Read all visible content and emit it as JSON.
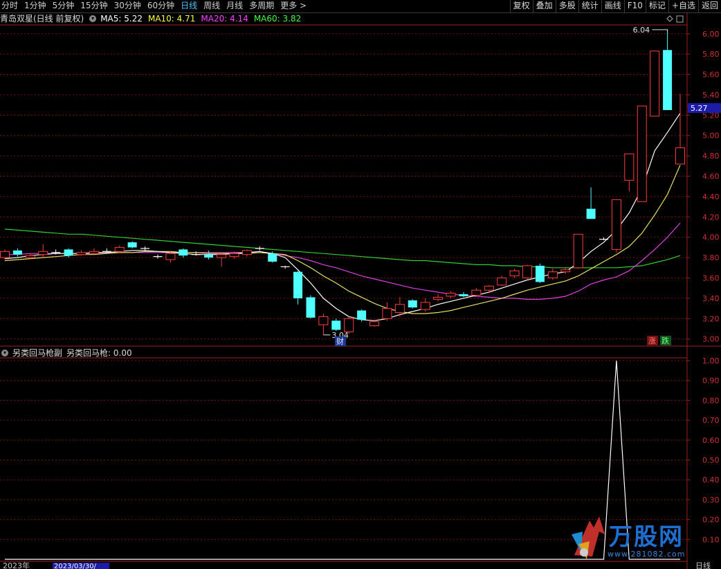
{
  "toolbar": {
    "periods": [
      "分时",
      "1分钟",
      "5分钟",
      "15分钟",
      "30分钟",
      "60分钟",
      "日线",
      "周线",
      "月线",
      "多周期",
      "更多 >"
    ],
    "active_period": "日线",
    "right_buttons": [
      "复权",
      "叠加",
      "多股",
      "统计",
      "画线",
      "F10",
      "标记",
      "+自选",
      "返回"
    ]
  },
  "main_info": {
    "stock": "青岛双星(日线 前复权)",
    "indicators": [
      {
        "label": "MA5: 5.22",
        "color": "#ffffff"
      },
      {
        "label": "MA10: 4.71",
        "color": "#ffff40"
      },
      {
        "label": "MA20: 4.14",
        "color": "#ff40ff"
      },
      {
        "label": "MA60: 3.82",
        "color": "#40ff40"
      }
    ]
  },
  "sub_info": {
    "name": "另类回马枪副",
    "value_label": "另类回马枪: 0.00"
  },
  "chart_data": [
    {
      "type": "candlestick",
      "y_ticks": [
        "6.00",
        "5.80",
        "5.60",
        "5.40",
        "5.20",
        "5.00",
        "4.80",
        "4.60",
        "4.40",
        "4.20",
        "4.00",
        "3.80",
        "3.60",
        "3.40",
        "3.20",
        "3.00"
      ],
      "ylim": [
        2.93,
        6.08
      ],
      "current_price": "5.27",
      "max_label": "6.04",
      "min_label": "3.04",
      "tag_cai": "财",
      "tag_up": "涨",
      "tag_down": "跌",
      "candles": [
        [
          3.8,
          3.86,
          3.88,
          3.78
        ],
        [
          3.87,
          3.83,
          3.89,
          3.81
        ],
        [
          3.8,
          3.82,
          3.84,
          3.79
        ],
        [
          3.83,
          3.86,
          3.93,
          3.8
        ],
        [
          3.85,
          3.84,
          3.88,
          3.83
        ],
        [
          3.88,
          3.82,
          3.89,
          3.8
        ],
        [
          3.83,
          3.85,
          3.87,
          3.82
        ],
        [
          3.84,
          3.86,
          3.89,
          3.83
        ],
        [
          3.86,
          3.87,
          3.89,
          3.85
        ],
        [
          3.86,
          3.9,
          3.92,
          3.84
        ],
        [
          3.95,
          3.9,
          3.96,
          3.89
        ],
        [
          3.89,
          3.88,
          3.91,
          3.86
        ],
        [
          3.81,
          3.81,
          3.83,
          3.79
        ],
        [
          3.78,
          3.84,
          3.86,
          3.75
        ],
        [
          3.88,
          3.82,
          3.89,
          3.8
        ],
        [
          3.83,
          3.84,
          3.86,
          3.82
        ],
        [
          3.83,
          3.8,
          3.87,
          3.78
        ],
        [
          3.8,
          3.83,
          3.84,
          3.71
        ],
        [
          3.81,
          3.84,
          3.86,
          3.79
        ],
        [
          3.83,
          3.87,
          3.88,
          3.81
        ],
        [
          3.89,
          3.89,
          3.91,
          3.87
        ],
        [
          3.84,
          3.76,
          3.86,
          3.75
        ],
        [
          3.71,
          3.71,
          3.72,
          3.69
        ],
        [
          3.66,
          3.4,
          3.67,
          3.34
        ],
        [
          3.41,
          3.21,
          3.43,
          3.2
        ],
        [
          3.14,
          3.22,
          3.25,
          3.04
        ],
        [
          3.18,
          3.09,
          3.2,
          3.08
        ],
        [
          3.07,
          3.2,
          3.22,
          3.05
        ],
        [
          3.28,
          3.19,
          3.29,
          3.17
        ],
        [
          3.13,
          3.17,
          3.18,
          3.12
        ],
        [
          3.2,
          3.3,
          3.36,
          3.18
        ],
        [
          3.26,
          3.34,
          3.41,
          3.22
        ],
        [
          3.38,
          3.31,
          3.39,
          3.3
        ],
        [
          3.29,
          3.36,
          3.4,
          3.27
        ],
        [
          3.39,
          3.41,
          3.44,
          3.37
        ],
        [
          3.42,
          3.45,
          3.47,
          3.4
        ],
        [
          3.44,
          3.42,
          3.46,
          3.41
        ],
        [
          3.43,
          3.48,
          3.5,
          3.42
        ],
        [
          3.48,
          3.52,
          3.53,
          3.46
        ],
        [
          3.53,
          3.6,
          3.62,
          3.52
        ],
        [
          3.62,
          3.67,
          3.69,
          3.6
        ],
        [
          3.6,
          3.72,
          3.73,
          3.58
        ],
        [
          3.72,
          3.56,
          3.74,
          3.55
        ],
        [
          3.6,
          3.66,
          3.69,
          3.58
        ],
        [
          3.66,
          3.68,
          3.7,
          3.64
        ],
        [
          3.7,
          4.03,
          4.03,
          3.69
        ],
        [
          4.28,
          4.18,
          4.49,
          4.18
        ],
        [
          3.98,
          3.98,
          4.0,
          3.97
        ],
        [
          3.88,
          4.37,
          4.37,
          3.85
        ],
        [
          4.56,
          4.82,
          4.82,
          4.45
        ],
        [
          4.35,
          5.29,
          5.29,
          4.35
        ],
        [
          5.19,
          5.83,
          5.83,
          5.19
        ],
        [
          5.84,
          5.25,
          6.04,
          5.25
        ],
        [
          4.72,
          4.88,
          5.41,
          4.72
        ]
      ],
      "ma5": [
        3.79,
        3.8,
        3.82,
        3.83,
        3.84,
        3.84,
        3.84,
        3.85,
        3.85,
        3.86,
        3.87,
        3.87,
        3.86,
        3.85,
        3.84,
        3.83,
        3.83,
        3.83,
        3.84,
        3.85,
        3.86,
        3.84,
        3.8,
        3.68,
        3.55,
        3.4,
        3.3,
        3.22,
        3.19,
        3.18,
        3.2,
        3.24,
        3.27,
        3.3,
        3.34,
        3.37,
        3.4,
        3.43,
        3.46,
        3.5,
        3.54,
        3.58,
        3.61,
        3.64,
        3.66,
        3.75,
        3.86,
        3.95,
        4.07,
        4.24,
        4.48,
        4.85,
        5.03,
        5.22
      ],
      "ma10": [
        3.77,
        3.78,
        3.79,
        3.8,
        3.81,
        3.82,
        3.83,
        3.83,
        3.84,
        3.85,
        3.85,
        3.86,
        3.86,
        3.86,
        3.85,
        3.85,
        3.84,
        3.84,
        3.84,
        3.84,
        3.85,
        3.84,
        3.83,
        3.77,
        3.7,
        3.62,
        3.55,
        3.47,
        3.41,
        3.35,
        3.3,
        3.27,
        3.25,
        3.25,
        3.26,
        3.28,
        3.31,
        3.34,
        3.37,
        3.4,
        3.44,
        3.48,
        3.51,
        3.54,
        3.57,
        3.62,
        3.69,
        3.76,
        3.83,
        3.91,
        4.04,
        4.22,
        4.42,
        4.71
      ],
      "ma20": [
        3.83,
        3.83,
        3.84,
        3.84,
        3.84,
        3.84,
        3.84,
        3.84,
        3.85,
        3.85,
        3.85,
        3.85,
        3.85,
        3.85,
        3.85,
        3.85,
        3.85,
        3.85,
        3.85,
        3.85,
        3.85,
        3.84,
        3.82,
        3.8,
        3.77,
        3.73,
        3.7,
        3.66,
        3.62,
        3.59,
        3.56,
        3.53,
        3.5,
        3.48,
        3.46,
        3.44,
        3.43,
        3.42,
        3.41,
        3.4,
        3.4,
        3.39,
        3.39,
        3.4,
        3.42,
        3.47,
        3.54,
        3.58,
        3.61,
        3.67,
        3.77,
        3.88,
        4.0,
        4.14
      ],
      "ma60": [
        4.08,
        4.07,
        4.06,
        4.05,
        4.04,
        4.03,
        4.03,
        4.02,
        4.01,
        4.0,
        3.99,
        3.98,
        3.97,
        3.96,
        3.95,
        3.94,
        3.93,
        3.92,
        3.91,
        3.9,
        3.89,
        3.88,
        3.87,
        3.86,
        3.85,
        3.84,
        3.83,
        3.82,
        3.81,
        3.8,
        3.79,
        3.78,
        3.77,
        3.77,
        3.76,
        3.75,
        3.74,
        3.73,
        3.73,
        3.72,
        3.72,
        3.71,
        3.71,
        3.7,
        3.7,
        3.7,
        3.7,
        3.7,
        3.7,
        3.71,
        3.72,
        3.75,
        3.78,
        3.82
      ]
    },
    {
      "type": "line",
      "name": "另类回马枪",
      "y_ticks": [
        "1.00",
        "0.90",
        "0.80",
        "0.70",
        "0.60",
        "0.50",
        "0.40",
        "0.30",
        "0.20",
        "0.10"
      ],
      "ylim": [
        0,
        1
      ],
      "values": [
        0,
        0,
        0,
        0,
        0,
        0,
        0,
        0,
        0,
        0,
        0,
        0,
        0,
        0,
        0,
        0,
        0,
        0,
        0,
        0,
        0,
        0,
        0,
        0,
        0,
        0,
        0,
        0,
        0,
        0,
        0,
        0,
        0,
        0,
        0,
        0,
        0,
        0,
        0,
        0,
        0,
        0,
        0,
        0,
        0,
        0,
        0,
        0,
        1,
        0,
        0,
        0,
        0,
        0
      ]
    }
  ],
  "bottom": {
    "date_left": "2023年",
    "date_cursor": "2023/03/30/",
    "period_label": "日线"
  },
  "watermark": {
    "brand": "万股网",
    "url": "www.281082.com"
  }
}
